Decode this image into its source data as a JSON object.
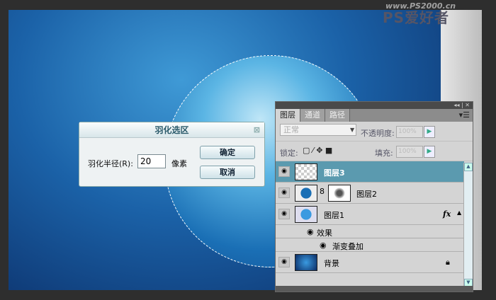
{
  "watermark": {
    "brand": "PS爱好者",
    "url": "www.PS2000.cn"
  },
  "dialog": {
    "title": "羽化选区",
    "close_icon": "close-icon",
    "label": "羽化半径(R):",
    "value": "20",
    "unit": "像素",
    "ok": "确定",
    "cancel": "取消"
  },
  "panel": {
    "tabs": [
      "图层",
      "通道",
      "路径"
    ],
    "blend_mode": "正常",
    "opacity_label": "不透明度:",
    "opacity": "100%",
    "lock_label": "锁定:",
    "fill_label": "填充:",
    "fill": "100%",
    "layers": [
      {
        "name": "图层3",
        "selected": true
      },
      {
        "name": "图层2"
      },
      {
        "name": "图层1",
        "fx": "fx"
      },
      {
        "name": "效果"
      },
      {
        "name": "渐变叠加"
      },
      {
        "name": "背景",
        "locked": true
      }
    ]
  },
  "colors": {
    "selected_layer": "#5b9aaf"
  }
}
